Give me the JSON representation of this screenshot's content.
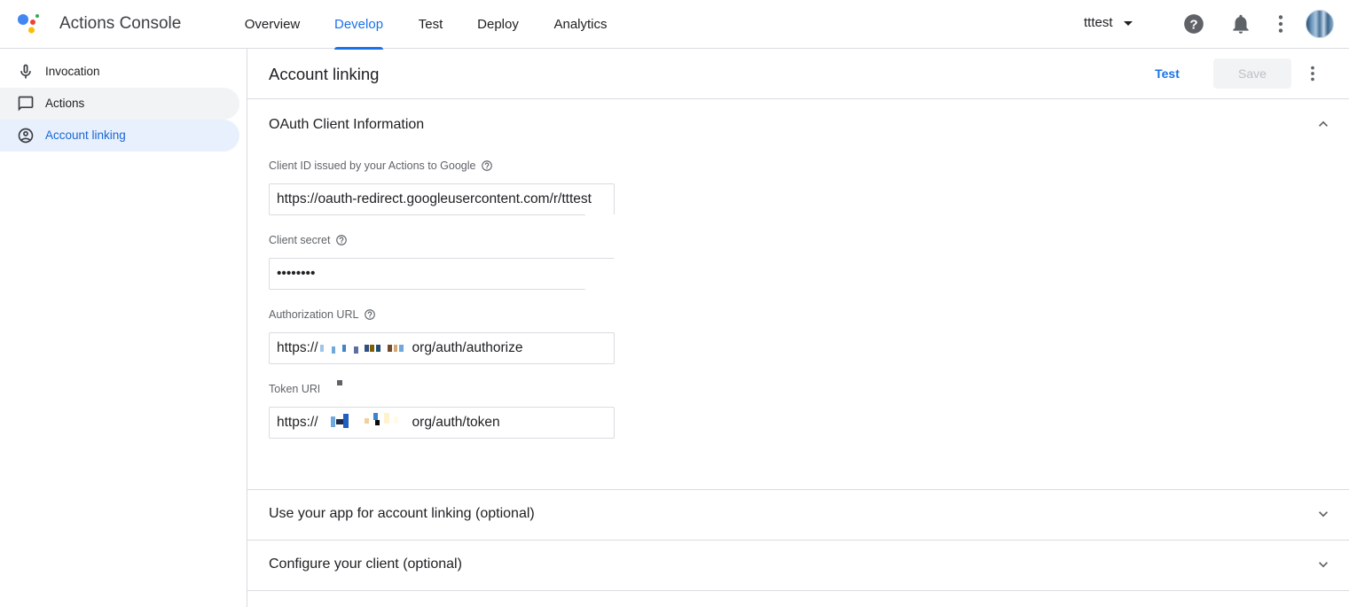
{
  "app": {
    "title": "Actions Console",
    "project": "tttest"
  },
  "nav": {
    "tabs": [
      {
        "label": "Overview"
      },
      {
        "label": "Develop"
      },
      {
        "label": "Test"
      },
      {
        "label": "Deploy"
      },
      {
        "label": "Analytics"
      }
    ],
    "active_tab": "Develop"
  },
  "topbar_icons": [
    "help-icon",
    "notifications-bell-icon",
    "more-vert-icon",
    "avatar"
  ],
  "sidebar": {
    "items": [
      {
        "label": "Invocation",
        "icon": "microphone-icon"
      },
      {
        "label": "Actions",
        "icon": "chat-bubble-icon"
      },
      {
        "label": "Account linking",
        "icon": "account-circle-icon"
      }
    ],
    "active_item": "Account linking"
  },
  "page": {
    "title": "Account linking",
    "test_label": "Test",
    "save_label": "Save"
  },
  "oauth_section": {
    "title": "OAuth Client Information",
    "fields": [
      {
        "label": "Client ID issued by your Actions to Google",
        "value": "https://oauth-redirect.googleusercontent.com/r/tttest"
      },
      {
        "label": "Client secret",
        "value": "••••••••"
      },
      {
        "label": "Authorization URL",
        "value_prefix": "https://",
        "value_suffix": "org/auth/authorize"
      },
      {
        "label": "Token URL",
        "value_prefix": "https://",
        "value_suffix": "org/auth/token"
      }
    ]
  },
  "collapsed_sections": [
    {
      "title": "Use your app for account linking (optional)"
    },
    {
      "title": "Configure your client (optional)"
    }
  ],
  "colors": {
    "accent": "#1a73e8",
    "active_bg": "#e8f0fe",
    "divider": "#dadce0"
  }
}
